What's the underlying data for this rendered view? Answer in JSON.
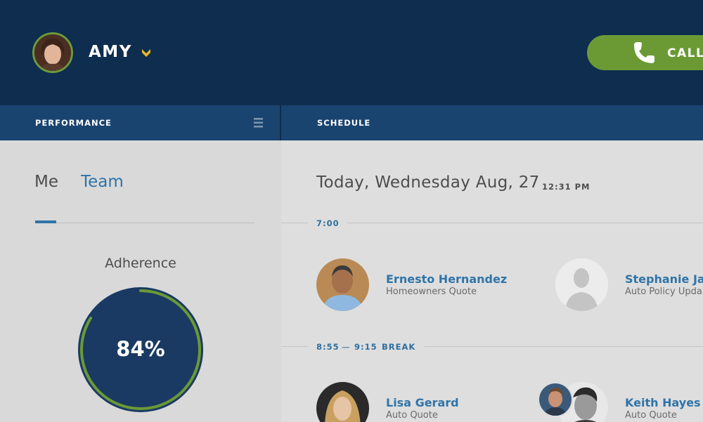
{
  "header": {
    "user_name": "AMY",
    "call_label": "CALL"
  },
  "sections": {
    "performance": "PERFORMANCE",
    "schedule": "SCHEDULE"
  },
  "performance": {
    "tabs": [
      "Me",
      "Team"
    ],
    "active_tab": "Me",
    "metric_title": "Adherence",
    "metric_value": "84%",
    "metric_fraction": 0.84
  },
  "schedule": {
    "date": "Today, Wednesday Aug, 27",
    "time": "12:31 PM",
    "slots": [
      {
        "time": "7:00",
        "appointments": [
          {
            "name": "Ernesto Hernandez",
            "subtitle": "Homeowners Quote"
          },
          {
            "name": "Stephanie Jac",
            "subtitle": "Auto Policy Upda"
          }
        ]
      },
      {
        "time": "8:55",
        "end": "9:15",
        "separator": "—",
        "label": "BREAK",
        "appointments": [
          {
            "name": "Lisa Gerard",
            "subtitle": "Auto Quote"
          },
          {
            "name": "Keith Hayes",
            "subtitle": "Auto Quote"
          }
        ]
      }
    ]
  },
  "colors": {
    "header_bg": "#0f2d4e",
    "bar_bg": "#1a4470",
    "accent_green": "#6b9a35",
    "accent_blue": "#2f74a8",
    "chevron_yellow": "#e8b923"
  },
  "icons": [
    "user-avatar",
    "chevron-down-icon",
    "phone-icon",
    "menu-icon",
    "person-placeholder-icon"
  ]
}
